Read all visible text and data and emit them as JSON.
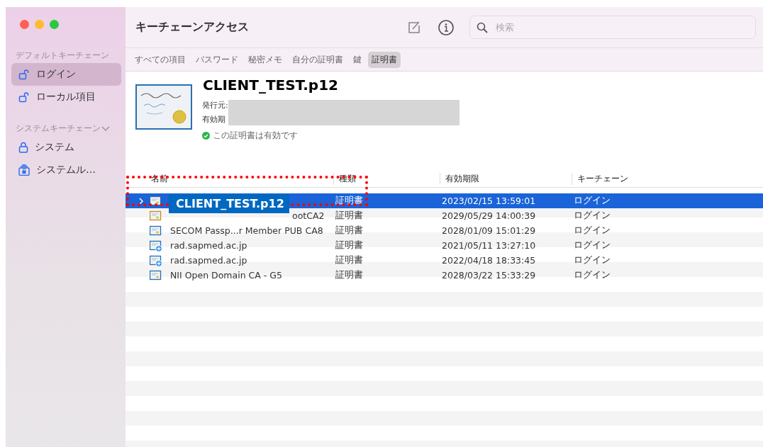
{
  "window": {
    "title": "キーチェーンアクセス"
  },
  "sidebar": {
    "sections": [
      {
        "label": "デフォルトキーチェーン",
        "items": [
          {
            "label": "ログイン",
            "kind": "unlock",
            "selected": true
          },
          {
            "label": "ローカル項目",
            "kind": "unlock",
            "selected": false
          }
        ]
      },
      {
        "label": "システムキーチェーン",
        "expanded": true,
        "items": [
          {
            "label": "システム",
            "kind": "lock",
            "selected": false
          },
          {
            "label": "システムル…",
            "kind": "cabinet",
            "selected": false
          }
        ]
      }
    ]
  },
  "search": {
    "placeholder": "検索"
  },
  "tabs": [
    {
      "label": "すべての項目",
      "selected": false
    },
    {
      "label": "パスワード",
      "selected": false
    },
    {
      "label": "秘密メモ",
      "selected": false
    },
    {
      "label": "自分の証明書",
      "selected": false
    },
    {
      "label": "鍵",
      "selected": false
    },
    {
      "label": "証明書",
      "selected": true
    }
  ],
  "detail": {
    "title": "CLIENT_TEST.p12",
    "issuer_label": "発行元:",
    "expiry_label": "有効期",
    "valid": true,
    "status": "この証明書は有効です"
  },
  "table": {
    "columns": [
      "名前",
      "種類",
      "有効期限",
      "キーチェーン"
    ],
    "rows": [
      {
        "expandable": true,
        "kind": "cert",
        "name": "",
        "type": "証明書",
        "expires": "2023/02/15 13:59:01",
        "keychain": "ログイン",
        "selected": true
      },
      {
        "expandable": false,
        "kind": "cert-gold",
        "name": "ootCA2",
        "type": "証明書",
        "expires": "2029/05/29 14:00:39",
        "keychain": "ログイン",
        "selected": false
      },
      {
        "expandable": false,
        "kind": "cert",
        "name": "SECOM Passp...r Member PUB CA8",
        "type": "証明書",
        "expires": "2028/01/09 15:01:29",
        "keychain": "ログイン",
        "selected": false
      },
      {
        "expandable": false,
        "kind": "cert-plus",
        "name": "rad.sapmed.ac.jp",
        "type": "証明書",
        "expires": "2021/05/11 13:27:10",
        "keychain": "ログイン",
        "selected": false
      },
      {
        "expandable": false,
        "kind": "cert-plus",
        "name": "rad.sapmed.ac.jp",
        "type": "証明書",
        "expires": "2022/04/18 18:33:45",
        "keychain": "ログイン",
        "selected": false
      },
      {
        "expandable": false,
        "kind": "cert",
        "name": "NII Open Domain CA - G5",
        "type": "証明書",
        "expires": "2028/03/22 15:33:29",
        "keychain": "ログイン",
        "selected": false
      }
    ]
  },
  "annotation": {
    "label": "CLIENT_TEST.p12"
  }
}
